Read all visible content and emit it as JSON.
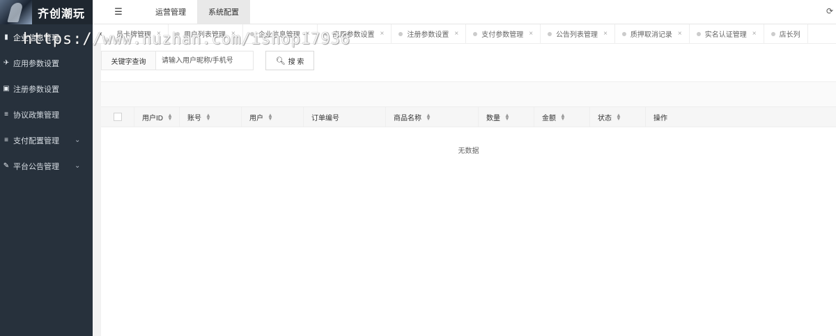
{
  "app": {
    "logo_text": "齐创潮玩"
  },
  "sidebar": {
    "items": [
      {
        "label": "企业信息管理",
        "icon": "book-icon"
      },
      {
        "label": "应用参数设置",
        "icon": "plane-icon"
      },
      {
        "label": "注册参数设置",
        "icon": "id-card-icon"
      },
      {
        "label": "协议政策管理",
        "icon": "list-icon"
      },
      {
        "label": "支付配置管理",
        "icon": "list-icon"
      },
      {
        "label": "平台公告管理",
        "icon": "edit-icon"
      }
    ]
  },
  "topbar": {
    "nav": [
      {
        "label": "运营管理"
      },
      {
        "label": "系统配置"
      }
    ]
  },
  "tabs": [
    {
      "label": "员卡牌管理"
    },
    {
      "label": "用户列表管理"
    },
    {
      "label": "企业信息管理"
    },
    {
      "label": "应用参数设置"
    },
    {
      "label": "注册参数设置"
    },
    {
      "label": "支付参数管理"
    },
    {
      "label": "公告列表管理"
    },
    {
      "label": "质押取消记录"
    },
    {
      "label": "实名认证管理"
    },
    {
      "label": "店长列"
    }
  ],
  "watermark": "https://www.huzhan.com/ishop17936",
  "search": {
    "label": "关键字查询",
    "placeholder": "请输入用户昵称/手机号",
    "button": "搜 索"
  },
  "table": {
    "columns": [
      {
        "label": "用户ID",
        "sortable": true
      },
      {
        "label": "账号",
        "sortable": true
      },
      {
        "label": "用户",
        "sortable": true
      },
      {
        "label": "订单编号",
        "sortable": false
      },
      {
        "label": "商品名称",
        "sortable": true
      },
      {
        "label": "数量",
        "sortable": true
      },
      {
        "label": "金额",
        "sortable": true
      },
      {
        "label": "状态",
        "sortable": true
      },
      {
        "label": "操作",
        "sortable": false
      }
    ],
    "empty_text": "无数据"
  }
}
